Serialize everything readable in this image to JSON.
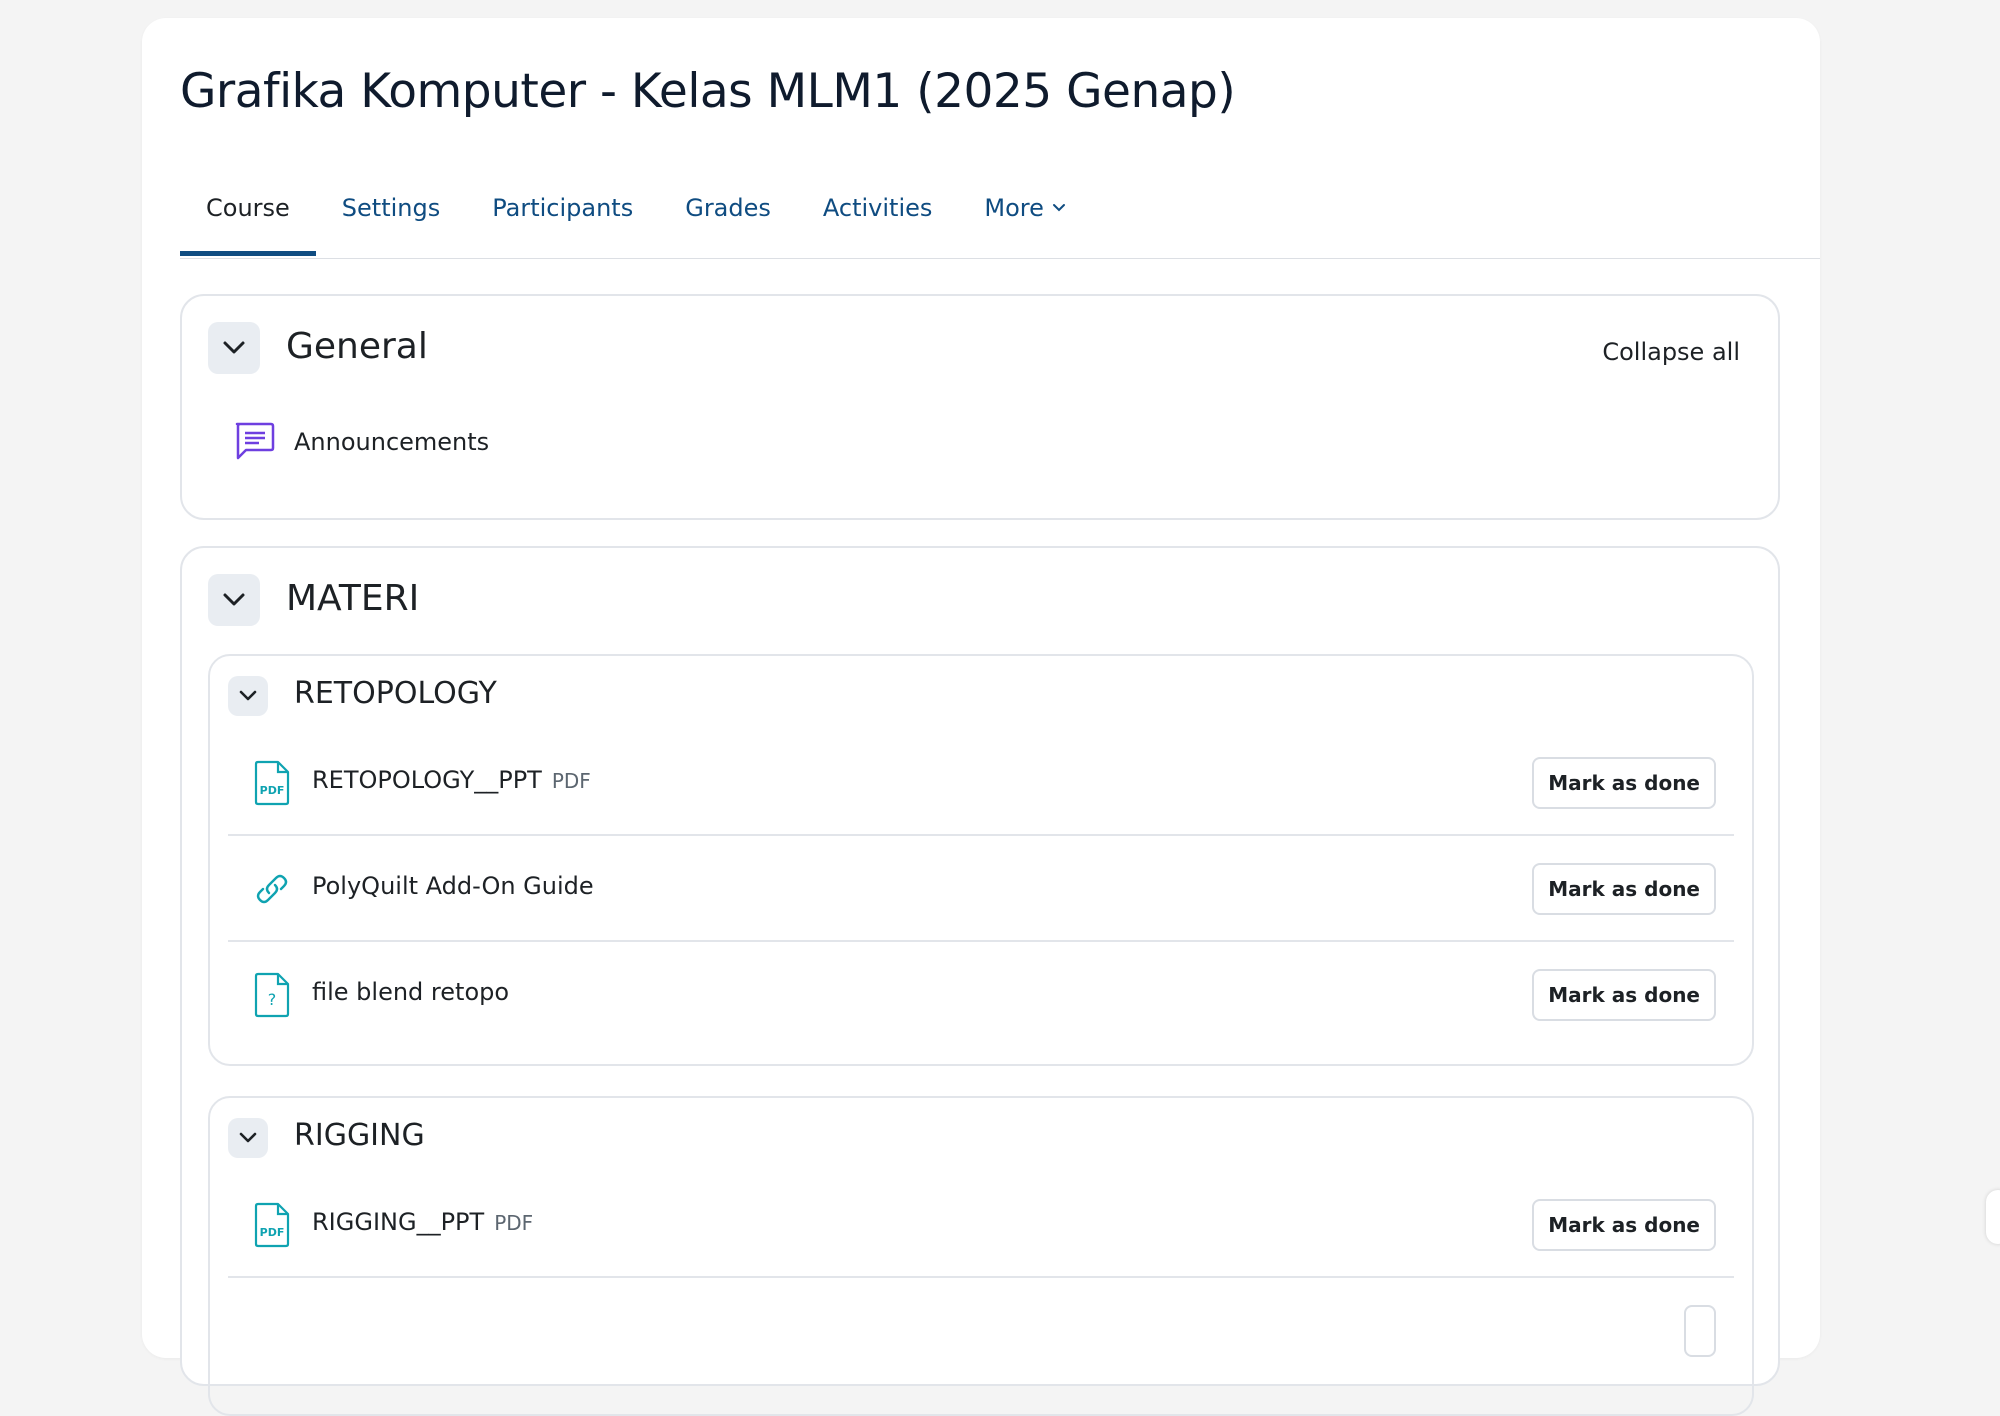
{
  "course": {
    "title": "Grafika Komputer - Kelas MLM1 (2025 Genap)"
  },
  "nav": {
    "tabs": [
      {
        "label": "Course",
        "active": true
      },
      {
        "label": "Settings"
      },
      {
        "label": "Participants"
      },
      {
        "label": "Grades"
      },
      {
        "label": "Activities"
      },
      {
        "label": "More"
      }
    ]
  },
  "sections": {
    "general": {
      "title": "General",
      "collapse_all": "Collapse all",
      "announcements": "Announcements"
    },
    "materi": {
      "title": "MATERI",
      "retopology": {
        "title": "RETOPOLOGY",
        "items": [
          {
            "name": "RETOPOLOGY__PPT",
            "type": "PDF",
            "icon": "pdf-icon",
            "action": "Mark as done"
          },
          {
            "name": "PolyQuilt Add-On Guide",
            "icon": "link-icon",
            "action": "Mark as done"
          },
          {
            "name": "file blend retopo",
            "icon": "unknown-file-icon",
            "action": "Mark as done"
          }
        ]
      },
      "rigging": {
        "title": "RIGGING",
        "items": [
          {
            "name": "RIGGING__PPT",
            "type": "PDF",
            "icon": "pdf-icon",
            "action": "Mark as done"
          }
        ]
      }
    }
  },
  "colors": {
    "link": "#0f4c81",
    "resource_icon": "#0fa3b1",
    "forum_icon": "#6e3fe0"
  }
}
